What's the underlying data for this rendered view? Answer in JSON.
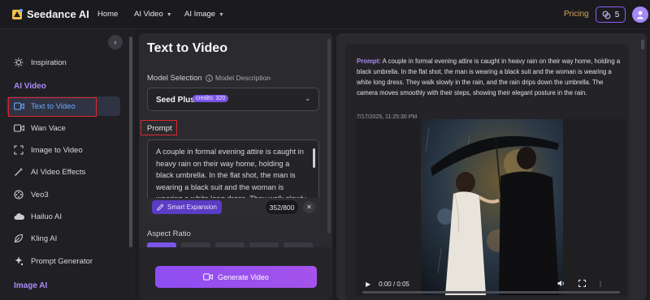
{
  "header": {
    "brand": "Seedance AI",
    "nav": [
      {
        "label": "Home"
      },
      {
        "label": "AI Video"
      },
      {
        "label": "AI Image"
      }
    ],
    "pricing": "Pricing",
    "credits": "5"
  },
  "sidebar": {
    "items": [
      {
        "label": "Inspiration",
        "icon": "sun-icon"
      },
      {
        "label": "Text to Video",
        "icon": "video-camera-icon",
        "active": true
      },
      {
        "label": "Wan Vace",
        "icon": "video-camera-icon"
      },
      {
        "label": "Image to Video",
        "icon": "expand-icon"
      },
      {
        "label": "AI Video Effects",
        "icon": "magic-wand-icon"
      },
      {
        "label": "Veo3",
        "icon": "film-reel-icon"
      },
      {
        "label": "Hailuo AI",
        "icon": "cloud-icon"
      },
      {
        "label": "Kling AI",
        "icon": "leaf-icon"
      },
      {
        "label": "Prompt Generator",
        "icon": "sparkle-icon"
      }
    ],
    "sections": {
      "ai_video": "AI Video",
      "image_ai": "Image AI"
    }
  },
  "form": {
    "title": "Text to Video",
    "model_label": "Model Selection",
    "model_desc": "Model Description",
    "model_name": "Seed Plus",
    "model_credits": "credits: 320",
    "prompt_label": "Prompt",
    "prompt_value": "A couple in formal evening attire is caught in heavy rain on their way home, holding a black umbrella. In the flat shot, the man is wearing a black suit and the woman is wearing a white long dress. They walk slowly in the rain, and the rain drips down",
    "smart_expansion": "Smart Expansion",
    "char_count": "352/800",
    "aspect_label": "Aspect Ratio",
    "generate_label": "Generate Video"
  },
  "result": {
    "prompt_key": "Prompt:",
    "prompt_text": "A couple in formal evening attire is caught in heavy rain on their way home, holding a black umbrella. In the flat shot, the man is wearing a black suit and the woman is wearing a white long dress. They walk slowly in the rain, and the rain drips down the umbrella. The camera moves smoothly with their steps, showing their elegant posture in the rain.",
    "timestamp": "7/17/2025, 11:25:30 PM",
    "video_time": "0:00 / 0:05",
    "progress_fraction": 0
  },
  "colors": {
    "accent": "#7a55e6",
    "active_link": "#6ea8ff",
    "pricing": "#d6a35a",
    "highlight": "#e0262b"
  }
}
